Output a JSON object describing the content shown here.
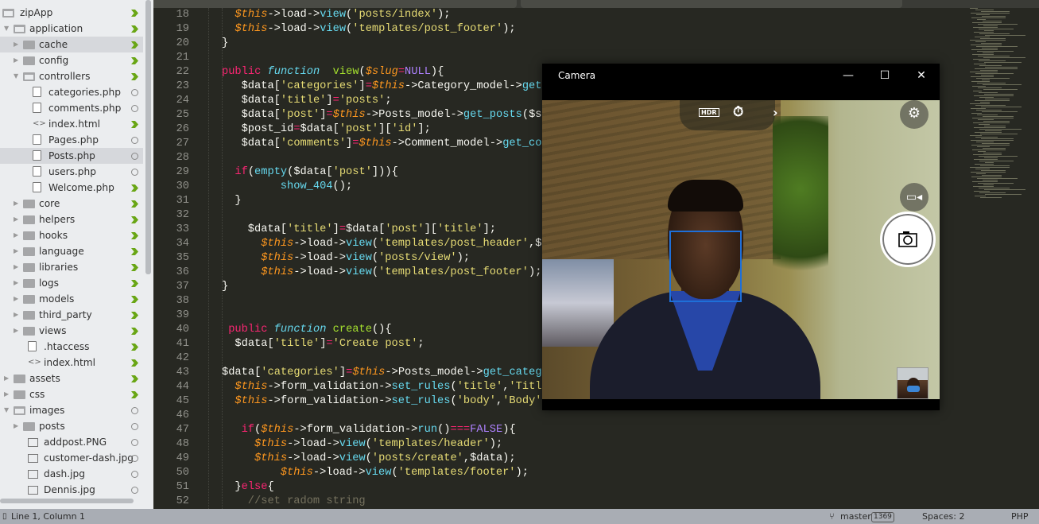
{
  "sidebar": {
    "items": [
      {
        "label": "zipApp",
        "depth": 0,
        "type": "folder-open",
        "arrow": "none",
        "status": "modified"
      },
      {
        "label": "application",
        "depth": 1,
        "type": "folder-open",
        "arrow": "down",
        "status": "modified"
      },
      {
        "label": "cache",
        "depth": 2,
        "type": "folder",
        "arrow": "right",
        "status": "modified",
        "hover": true
      },
      {
        "label": "config",
        "depth": 2,
        "type": "folder",
        "arrow": "right",
        "status": "modified"
      },
      {
        "label": "controllers",
        "depth": 2,
        "type": "folder-open",
        "arrow": "down",
        "status": "modified"
      },
      {
        "label": "categories.php",
        "depth": 3,
        "type": "file",
        "status": "untracked"
      },
      {
        "label": "comments.php",
        "depth": 3,
        "type": "file",
        "status": "untracked"
      },
      {
        "label": "index.html",
        "depth": 3,
        "type": "code",
        "status": "modified"
      },
      {
        "label": "Pages.php",
        "depth": 3,
        "type": "file",
        "status": "untracked"
      },
      {
        "label": "Posts.php",
        "depth": 3,
        "type": "file",
        "status": "untracked",
        "selected": true
      },
      {
        "label": "users.php",
        "depth": 3,
        "type": "file",
        "status": "untracked"
      },
      {
        "label": "Welcome.php",
        "depth": 3,
        "type": "file",
        "status": "modified"
      },
      {
        "label": "core",
        "depth": 2,
        "type": "folder",
        "arrow": "right",
        "status": "modified"
      },
      {
        "label": "helpers",
        "depth": 2,
        "type": "folder",
        "arrow": "right",
        "status": "modified"
      },
      {
        "label": "hooks",
        "depth": 2,
        "type": "folder",
        "arrow": "right",
        "status": "modified"
      },
      {
        "label": "language",
        "depth": 2,
        "type": "folder",
        "arrow": "right",
        "status": "modified"
      },
      {
        "label": "libraries",
        "depth": 2,
        "type": "folder",
        "arrow": "right",
        "status": "modified"
      },
      {
        "label": "logs",
        "depth": 2,
        "type": "folder",
        "arrow": "right",
        "status": "modified"
      },
      {
        "label": "models",
        "depth": 2,
        "type": "folder",
        "arrow": "right",
        "status": "modified"
      },
      {
        "label": "third_party",
        "depth": 2,
        "type": "folder",
        "arrow": "right",
        "status": "modified"
      },
      {
        "label": "views",
        "depth": 2,
        "type": "folder",
        "arrow": "right",
        "status": "modified"
      },
      {
        "label": ".htaccess",
        "depth": 2.5,
        "type": "file",
        "status": "modified"
      },
      {
        "label": "index.html",
        "depth": 2.5,
        "type": "code",
        "status": "modified"
      },
      {
        "label": "assets",
        "depth": 1,
        "type": "folder",
        "arrow": "right",
        "status": "modified"
      },
      {
        "label": "css",
        "depth": 1,
        "type": "folder",
        "arrow": "right",
        "status": "modified"
      },
      {
        "label": "images",
        "depth": 1,
        "type": "folder-open",
        "arrow": "down",
        "status": "untracked"
      },
      {
        "label": "posts",
        "depth": 2,
        "type": "folder",
        "arrow": "right",
        "status": "untracked"
      },
      {
        "label": "addpost.PNG",
        "depth": 2.5,
        "type": "image",
        "status": "untracked"
      },
      {
        "label": "customer-dash.jpg",
        "depth": 2.5,
        "type": "image",
        "status": "untracked"
      },
      {
        "label": "dash.jpg",
        "depth": 2.5,
        "type": "image",
        "status": "untracked"
      },
      {
        "label": "Dennis.jpg",
        "depth": 2.5,
        "type": "image",
        "status": "untracked"
      }
    ]
  },
  "editor": {
    "lines": [
      {
        "n": "18",
        "i": 2,
        "t": [
          [
            "v",
            "$this"
          ],
          [
            "p",
            "->load->"
          ],
          [
            "c",
            "view"
          ],
          [
            "p",
            "("
          ],
          [
            "q",
            "'posts/index'"
          ],
          [
            "p",
            ");"
          ]
        ]
      },
      {
        "n": "19",
        "i": 2,
        "t": [
          [
            "v",
            "$this"
          ],
          [
            "p",
            "->load->"
          ],
          [
            "c",
            "view"
          ],
          [
            "p",
            "("
          ],
          [
            "q",
            "'templates/post_footer'"
          ],
          [
            "p",
            ");"
          ]
        ]
      },
      {
        "n": "20",
        "i": 0,
        "t": [
          [
            "p",
            "}"
          ]
        ]
      },
      {
        "n": "21",
        "i": 0,
        "t": []
      },
      {
        "n": "22",
        "i": 0,
        "t": [
          [
            "k",
            "public"
          ],
          [
            "p",
            " "
          ],
          [
            "s",
            "function"
          ],
          [
            "p",
            "  "
          ],
          [
            "f",
            "view"
          ],
          [
            "p",
            "("
          ],
          [
            "v",
            "$slug"
          ],
          [
            "o",
            "="
          ],
          [
            "n",
            "NULL"
          ],
          [
            "p",
            "){"
          ]
        ]
      },
      {
        "n": "23",
        "i": 3,
        "t": [
          [
            "p",
            "$data["
          ],
          [
            "q",
            "'categories'"
          ],
          [
            "p",
            "]"
          ],
          [
            "o",
            "="
          ],
          [
            "v",
            "$this"
          ],
          [
            "p",
            "->Category_model->"
          ],
          [
            "c",
            "get"
          ]
        ]
      },
      {
        "n": "24",
        "i": 3,
        "t": [
          [
            "p",
            "$data["
          ],
          [
            "q",
            "'title'"
          ],
          [
            "p",
            "]"
          ],
          [
            "o",
            "="
          ],
          [
            "q",
            "'posts'"
          ],
          [
            "p",
            ";"
          ]
        ]
      },
      {
        "n": "25",
        "i": 3,
        "t": [
          [
            "p",
            "$data["
          ],
          [
            "q",
            "'post'"
          ],
          [
            "p",
            "]"
          ],
          [
            "o",
            "="
          ],
          [
            "v",
            "$this"
          ],
          [
            "p",
            "->Posts_model->"
          ],
          [
            "c",
            "get_posts"
          ],
          [
            "p",
            "($s"
          ]
        ]
      },
      {
        "n": "26",
        "i": 3,
        "t": [
          [
            "p",
            "$post_id"
          ],
          [
            "o",
            "="
          ],
          [
            "p",
            "$data["
          ],
          [
            "q",
            "'post'"
          ],
          [
            "p",
            "]["
          ],
          [
            "q",
            "'id'"
          ],
          [
            "p",
            "];"
          ]
        ]
      },
      {
        "n": "27",
        "i": 3,
        "t": [
          [
            "p",
            "$data["
          ],
          [
            "q",
            "'comments'"
          ],
          [
            "p",
            "]"
          ],
          [
            "o",
            "="
          ],
          [
            "v",
            "$this"
          ],
          [
            "p",
            "->Comment_model->"
          ],
          [
            "c",
            "get_co"
          ]
        ]
      },
      {
        "n": "28",
        "i": 0,
        "t": []
      },
      {
        "n": "29",
        "i": 2,
        "t": [
          [
            "k",
            "if"
          ],
          [
            "p",
            "("
          ],
          [
            "c",
            "empty"
          ],
          [
            "p",
            "($data["
          ],
          [
            "q",
            "'post'"
          ],
          [
            "p",
            "])){"
          ]
        ]
      },
      {
        "n": "30",
        "i": 9,
        "t": [
          [
            "c",
            "show_404"
          ],
          [
            "p",
            "();"
          ]
        ]
      },
      {
        "n": "31",
        "i": 2,
        "t": [
          [
            "p",
            "}"
          ]
        ]
      },
      {
        "n": "32",
        "i": 0,
        "t": []
      },
      {
        "n": "33",
        "i": 4,
        "t": [
          [
            "p",
            "$data["
          ],
          [
            "q",
            "'title'"
          ],
          [
            "p",
            "]"
          ],
          [
            "o",
            "="
          ],
          [
            "p",
            "$data["
          ],
          [
            "q",
            "'post'"
          ],
          [
            "p",
            "]["
          ],
          [
            "q",
            "'title'"
          ],
          [
            "p",
            "];"
          ]
        ]
      },
      {
        "n": "34",
        "i": 6,
        "t": [
          [
            "v",
            "$this"
          ],
          [
            "p",
            "->load->"
          ],
          [
            "c",
            "view"
          ],
          [
            "p",
            "("
          ],
          [
            "q",
            "'templates/post_header'"
          ],
          [
            "p",
            ",$"
          ]
        ]
      },
      {
        "n": "35",
        "i": 6,
        "t": [
          [
            "v",
            "$this"
          ],
          [
            "p",
            "->load->"
          ],
          [
            "c",
            "view"
          ],
          [
            "p",
            "("
          ],
          [
            "q",
            "'posts/view'"
          ],
          [
            "p",
            ");"
          ]
        ]
      },
      {
        "n": "36",
        "i": 6,
        "t": [
          [
            "v",
            "$this"
          ],
          [
            "p",
            "->load->"
          ],
          [
            "c",
            "view"
          ],
          [
            "p",
            "("
          ],
          [
            "q",
            "'templates/post_footer'"
          ],
          [
            "p",
            ");"
          ]
        ]
      },
      {
        "n": "37",
        "i": 0,
        "t": [
          [
            "p",
            "}"
          ]
        ]
      },
      {
        "n": "38",
        "i": 0,
        "t": []
      },
      {
        "n": "39",
        "i": 0,
        "t": []
      },
      {
        "n": "40",
        "i": 1,
        "t": [
          [
            "k",
            "public"
          ],
          [
            "p",
            " "
          ],
          [
            "s",
            "function"
          ],
          [
            "p",
            " "
          ],
          [
            "f",
            "create"
          ],
          [
            "p",
            "(){"
          ]
        ]
      },
      {
        "n": "41",
        "i": 2,
        "t": [
          [
            "p",
            "$data["
          ],
          [
            "q",
            "'title'"
          ],
          [
            "p",
            "]"
          ],
          [
            "o",
            "="
          ],
          [
            "q",
            "'Create post'"
          ],
          [
            "p",
            ";"
          ]
        ]
      },
      {
        "n": "42",
        "i": 0,
        "t": []
      },
      {
        "n": "43",
        "i": 0,
        "t": [
          [
            "p",
            "$data["
          ],
          [
            "q",
            "'categories'"
          ],
          [
            "p",
            "]"
          ],
          [
            "o",
            "="
          ],
          [
            "v",
            "$this"
          ],
          [
            "p",
            "->Posts_model->"
          ],
          [
            "c",
            "get_categ"
          ]
        ]
      },
      {
        "n": "44",
        "i": 2,
        "t": [
          [
            "v",
            "$this"
          ],
          [
            "p",
            "->form_validation->"
          ],
          [
            "c",
            "set_rules"
          ],
          [
            "p",
            "("
          ],
          [
            "q",
            "'title'"
          ],
          [
            "p",
            ","
          ],
          [
            "q",
            "'Titl"
          ]
        ]
      },
      {
        "n": "45",
        "i": 2,
        "t": [
          [
            "v",
            "$this"
          ],
          [
            "p",
            "->form_validation->"
          ],
          [
            "c",
            "set_rules"
          ],
          [
            "p",
            "("
          ],
          [
            "q",
            "'body'"
          ],
          [
            "p",
            ","
          ],
          [
            "q",
            "'Body'"
          ]
        ]
      },
      {
        "n": "46",
        "i": 0,
        "t": []
      },
      {
        "n": "47",
        "i": 3,
        "t": [
          [
            "k",
            "if"
          ],
          [
            "p",
            "("
          ],
          [
            "v",
            "$this"
          ],
          [
            "p",
            "->form_validation->"
          ],
          [
            "c",
            "run"
          ],
          [
            "p",
            "()"
          ],
          [
            "o",
            "==="
          ],
          [
            "n",
            "FALSE"
          ],
          [
            "p",
            "){"
          ]
        ]
      },
      {
        "n": "48",
        "i": 5,
        "t": [
          [
            "v",
            "$this"
          ],
          [
            "p",
            "->load->"
          ],
          [
            "c",
            "view"
          ],
          [
            "p",
            "("
          ],
          [
            "q",
            "'templates/header'"
          ],
          [
            "p",
            ");"
          ]
        ]
      },
      {
        "n": "49",
        "i": 5,
        "t": [
          [
            "v",
            "$this"
          ],
          [
            "p",
            "->load->"
          ],
          [
            "c",
            "view"
          ],
          [
            "p",
            "("
          ],
          [
            "q",
            "'posts/create'"
          ],
          [
            "p",
            ",$data);"
          ]
        ]
      },
      {
        "n": "50",
        "i": 9,
        "t": [
          [
            "v",
            "$this"
          ],
          [
            "p",
            "->load->"
          ],
          [
            "c",
            "view"
          ],
          [
            "p",
            "("
          ],
          [
            "q",
            "'templates/footer'"
          ],
          [
            "p",
            ");"
          ]
        ]
      },
      {
        "n": "51",
        "i": 2,
        "t": [
          [
            "p",
            "}"
          ],
          [
            "k",
            "else"
          ],
          [
            "p",
            "{"
          ]
        ]
      },
      {
        "n": "52",
        "i": 4,
        "t": [
          [
            "m",
            "//set radom string"
          ]
        ]
      }
    ]
  },
  "status": {
    "position": "Line 1, Column 1",
    "branch": "master",
    "branch_count": "1369",
    "indent": "Spaces: 2",
    "syntax": "PHP"
  },
  "camera": {
    "title": "Camera",
    "minimize": "—",
    "maximize": "☐",
    "close": "✕",
    "hdr_label": "HDR",
    "next": "›"
  },
  "colors": {
    "editor_bg": "#272822",
    "modified": "#69a615",
    "face_box": "#1e6fd9"
  }
}
